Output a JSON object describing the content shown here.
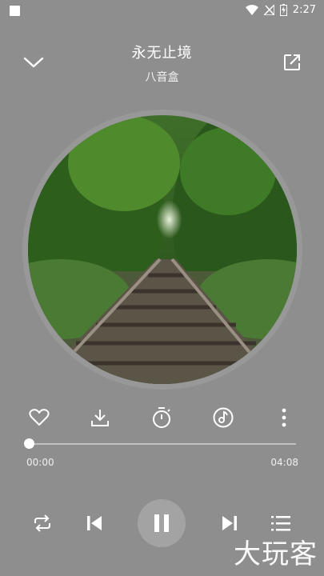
{
  "status_bar": {
    "time": "2:27"
  },
  "song": {
    "title": "永无止境",
    "artist": "八音盒"
  },
  "player": {
    "elapsed": "00:00",
    "duration": "04:08",
    "progress": 0.0
  },
  "icons": {
    "back": "chevron-down-icon",
    "share": "share-icon",
    "like": "heart-icon",
    "download": "download-icon",
    "timer": "timer-icon",
    "sound": "sound-effect-icon",
    "more": "more-vertical-icon",
    "repeat": "repeat-icon",
    "prev": "previous-icon",
    "pause": "pause-icon",
    "next": "next-icon",
    "playlist": "playlist-icon"
  },
  "watermark": "大玩客",
  "colors": {
    "background": "#8e8e8e",
    "foreground": "#ffffff"
  }
}
